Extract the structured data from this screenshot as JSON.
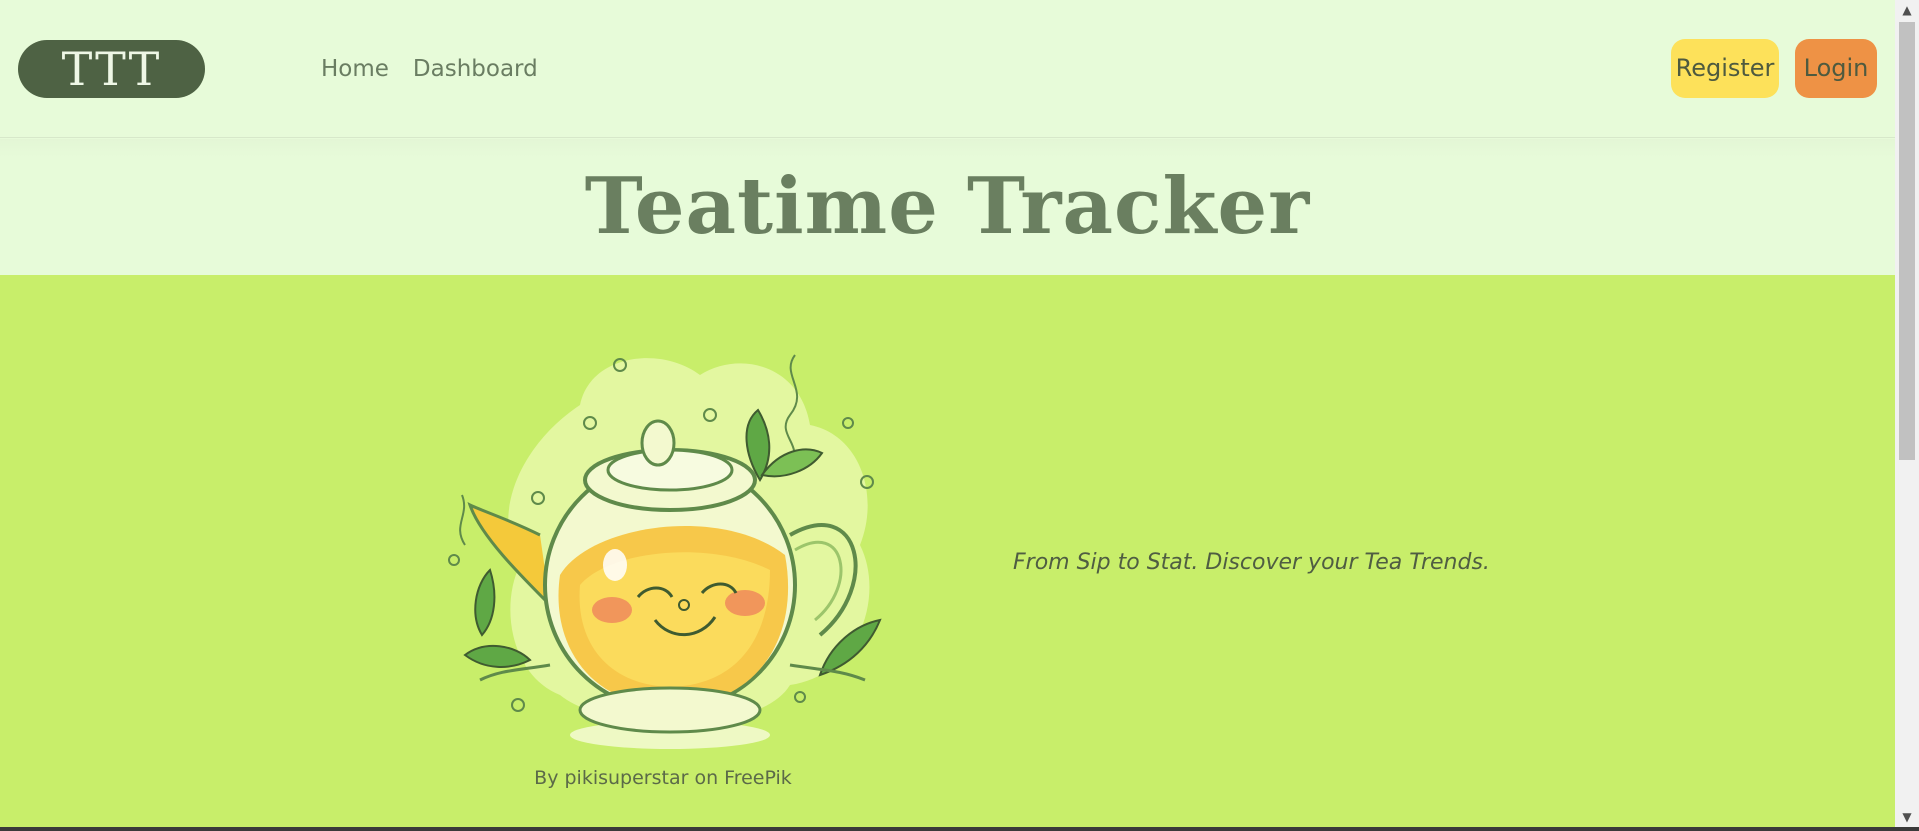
{
  "navbar": {
    "brand": "TTT",
    "links": [
      "Home",
      "Dashboard"
    ],
    "register_label": "Register",
    "login_label": "Login"
  },
  "hero": {
    "title": "Teatime Tracker"
  },
  "content": {
    "tagline": "From Sip to Stat. Discover your Tea Trends.",
    "image_credit": "By pikisuperstar on FreePik"
  },
  "scrollbar": {
    "up_icon": "chevron-up-icon",
    "down_icon": "chevron-down-icon"
  },
  "colors": {
    "page_bg": "#e7fbd9",
    "content_bg": "#c8ee6a",
    "brand_bg": "#4e6244",
    "register_bg": "#fde15a",
    "login_bg": "#ee9245",
    "title_color": "#6a7f60"
  }
}
